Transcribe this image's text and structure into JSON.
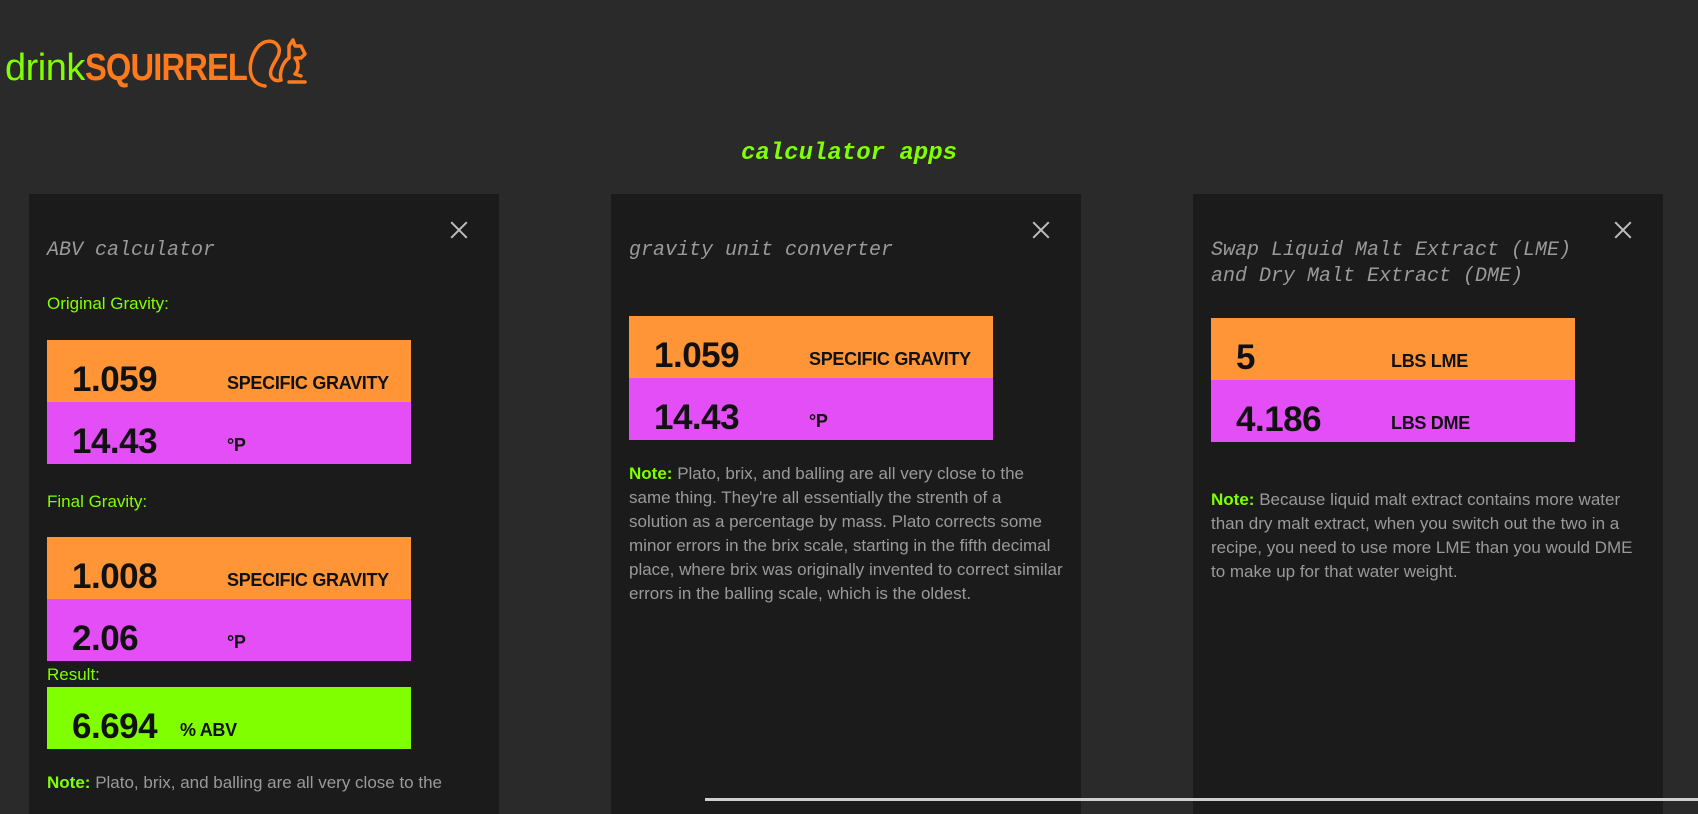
{
  "brand": {
    "part1": "drink",
    "part2": "SQUIRREL"
  },
  "page_title": "calculator apps",
  "abv": {
    "title": "ABV calculator",
    "og_label": "Original Gravity:",
    "og_sg": "1.059",
    "og_sg_unit": "SPECIFIC GRAVITY",
    "og_p": "14.43",
    "og_p_unit": "°P",
    "fg_label": "Final Gravity:",
    "fg_sg": "1.008",
    "fg_sg_unit": "SPECIFIC GRAVITY",
    "fg_p": "2.06",
    "fg_p_unit": "°P",
    "result_label": "Result:",
    "result_value": "6.694",
    "result_unit": "% ABV",
    "note_label": "Note:",
    "note_text": "Plato, brix, and balling are all very close to the"
  },
  "gravity": {
    "title": "gravity unit converter",
    "sg": "1.059",
    "sg_unit": "SPECIFIC GRAVITY",
    "p": "14.43",
    "p_unit": "°P",
    "note_label": "Note:",
    "note_text": "Plato, brix, and balling are all very close to the same thing. They're all essentially the strenth of a solution as a percentage by mass. Plato corrects some minor errors in the brix scale, starting in the fifth decimal place, where brix was originally invented to correct similar errors in the balling scale, which is the oldest."
  },
  "lme": {
    "title": "Swap Liquid Malt Extract (LME) and Dry Malt Extract (DME)",
    "lme_value": "5",
    "lme_unit": "LBS LME",
    "dme_value": "4.186",
    "dme_unit": "LBS DME",
    "note_label": "Note:",
    "note_text": "Because liquid malt extract contains more water than dry malt extract, when you switch out the two in a recipe, you need to use more LME than you would DME to make up for that water weight."
  },
  "colors": {
    "accent_green": "#7fff00",
    "brand_orange": "#ff7a1a",
    "box_orange": "#ff9536",
    "box_pink": "#e44ef7",
    "box_green": "#80ff00"
  }
}
